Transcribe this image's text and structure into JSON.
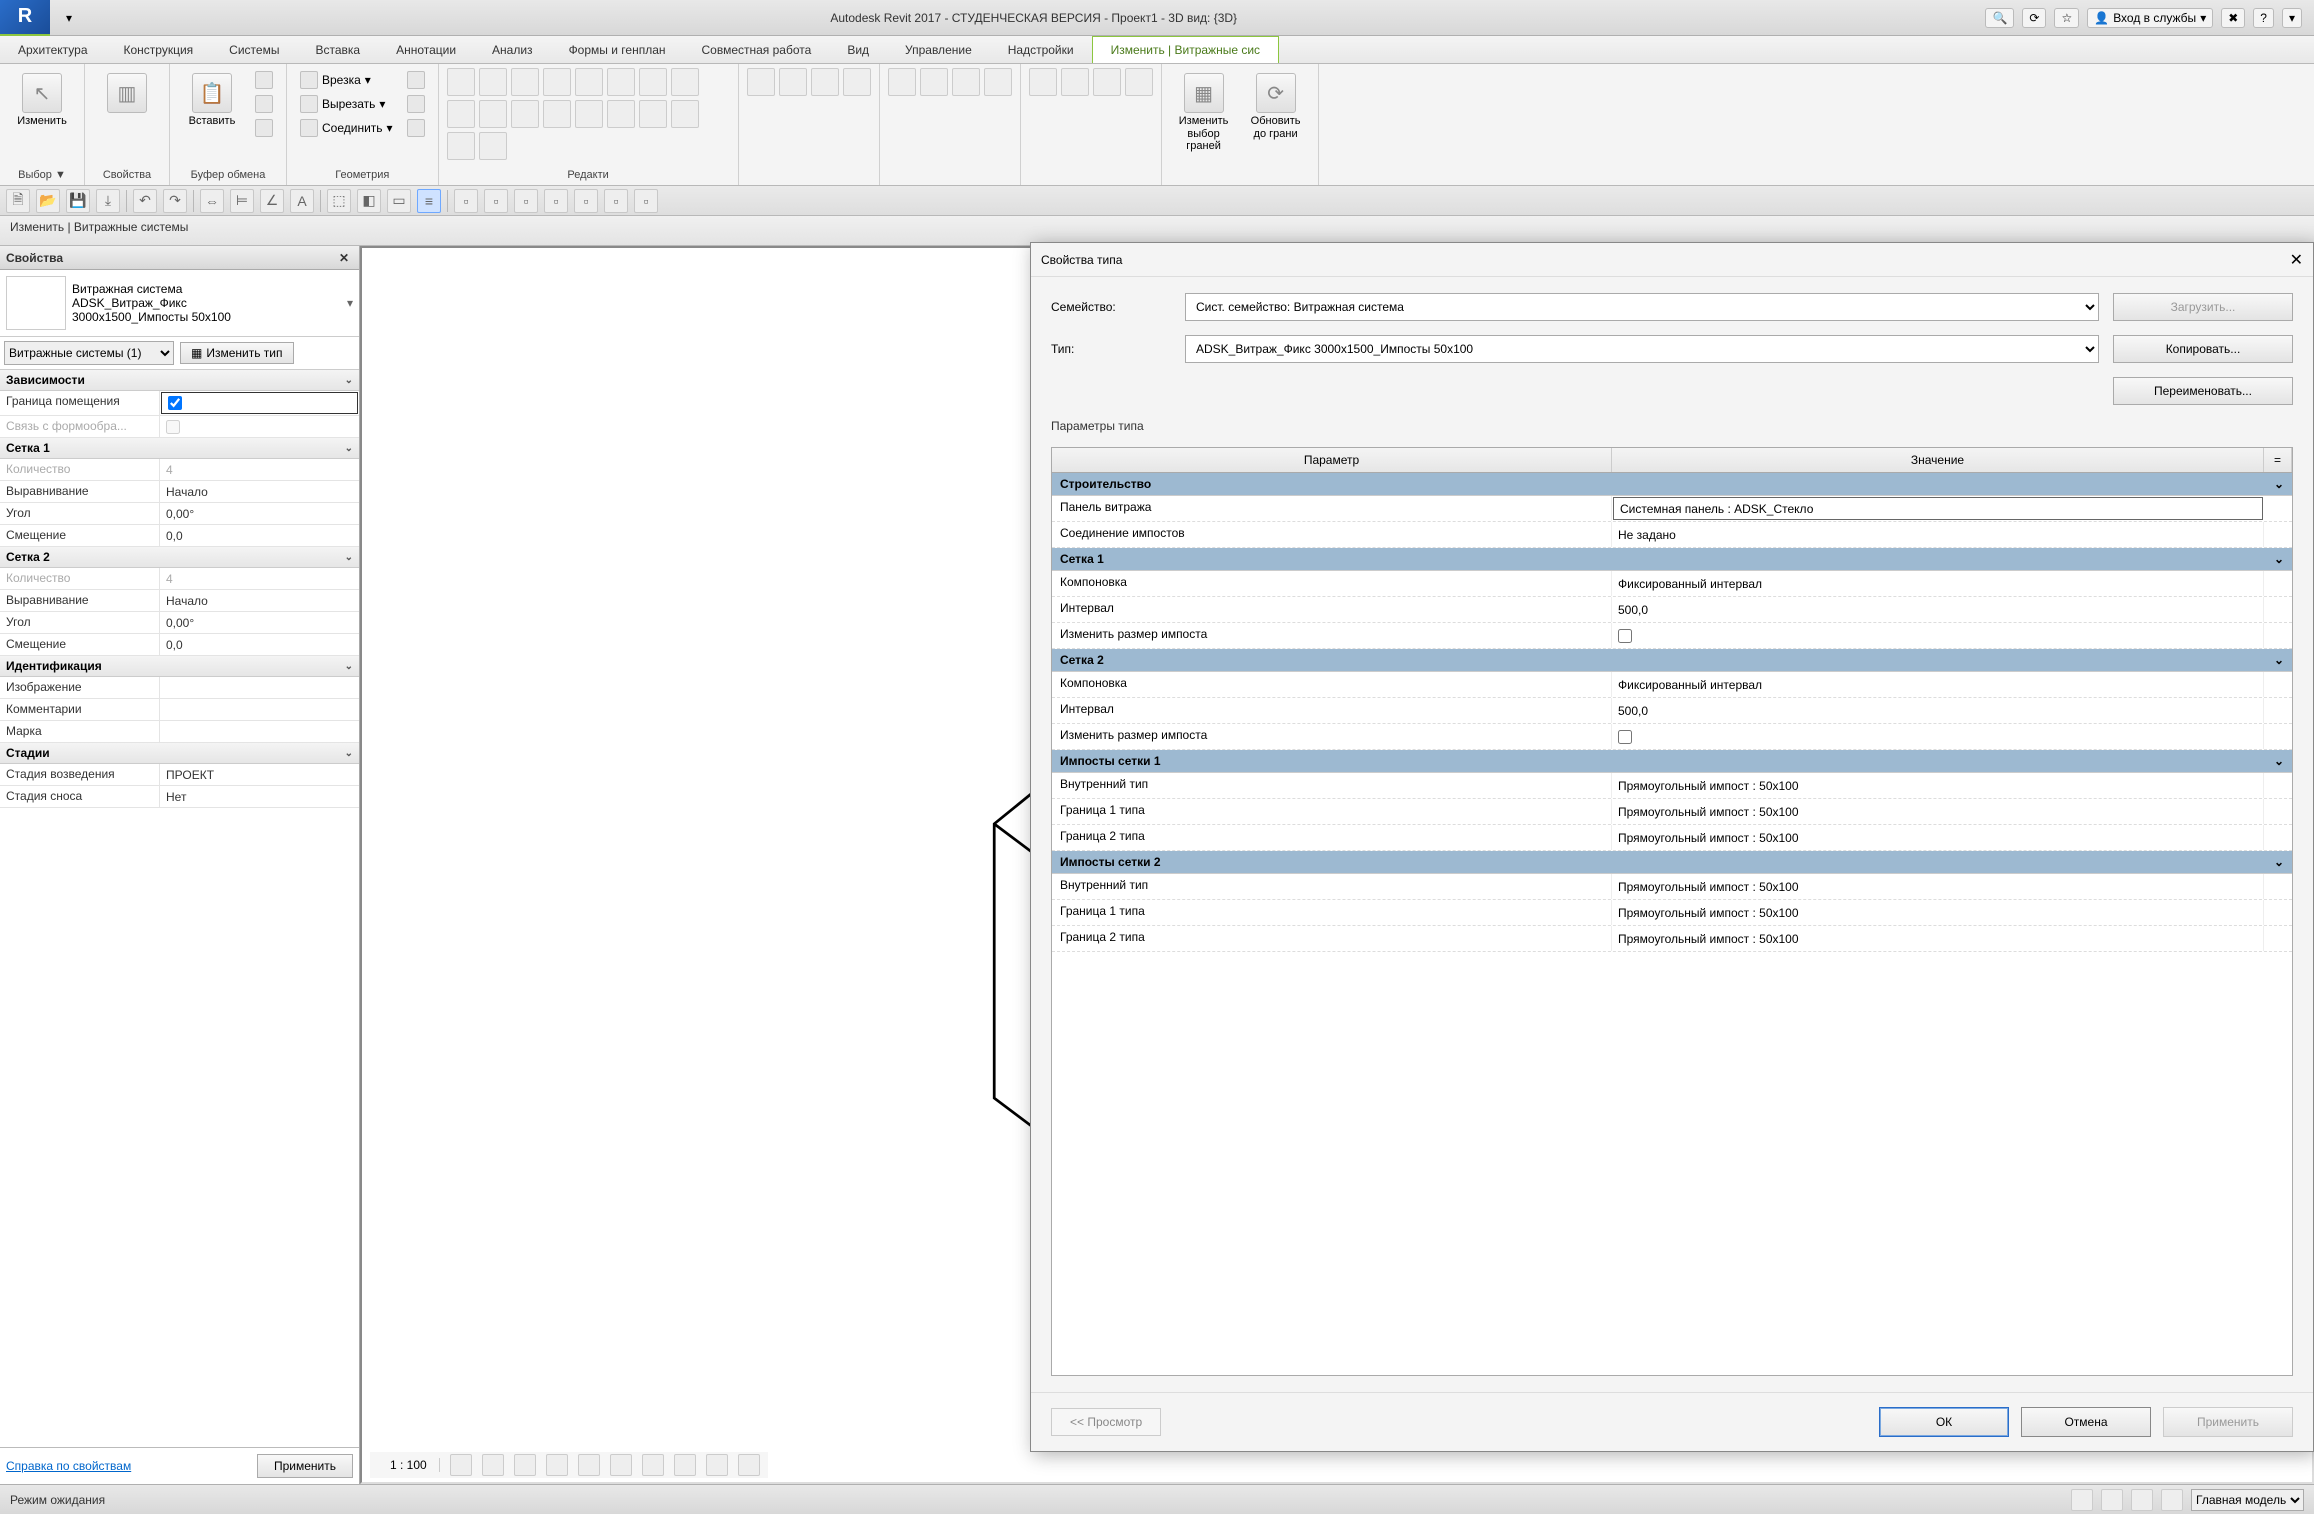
{
  "titlebar": {
    "app": "Autodesk Revit 2017 - СТУДЕНЧЕСКАЯ ВЕРСИЯ -    Проект1 - 3D вид: {3D}",
    "logo": "R",
    "signin": "Вход в службы"
  },
  "menubar": {
    "items": [
      "Архитектура",
      "Конструкция",
      "Системы",
      "Вставка",
      "Аннотации",
      "Анализ",
      "Формы и генплан",
      "Совместная работа",
      "Вид",
      "Управление",
      "Надстройки",
      "Изменить | Витражные сис"
    ]
  },
  "ribbon": {
    "panels": [
      {
        "label": "Выбор ▼",
        "big": [
          {
            "t": "Изменить"
          }
        ]
      },
      {
        "label": "Свойства",
        "big": [
          {
            "t": ""
          }
        ]
      },
      {
        "label": "Буфер обмена",
        "big": [
          {
            "t": "Вставить"
          }
        ]
      },
      {
        "label": "Геометрия",
        "small": [
          "Врезка",
          "Вырезать",
          "Соединить"
        ]
      },
      {
        "label": "Редакти"
      },
      {
        "label": ""
      },
      {
        "label": ""
      },
      {
        "label": "",
        "big": [
          {
            "t": "Изменить выбор граней"
          },
          {
            "t": "Обновить до грани"
          }
        ]
      }
    ]
  },
  "contextbar": {
    "text": "Изменить | Витражные системы"
  },
  "props": {
    "title": "Свойства",
    "type_header": "Витражная система",
    "type_line2": "ADSK_Витраж_Фикс",
    "type_line3": "3000x1500_Импосты 50x100",
    "filter": "Витражные системы (1)",
    "edit_type": "Изменить тип",
    "groups": [
      {
        "name": "Зависимости",
        "rows": [
          {
            "k": "Граница помещения",
            "v": "",
            "check": true,
            "checked": true,
            "frame": true
          },
          {
            "k": "Связь с формообра...",
            "v": "",
            "check": true,
            "checked": false,
            "dis": true
          }
        ]
      },
      {
        "name": "Сетка 1",
        "rows": [
          {
            "k": "Количество",
            "v": "4",
            "dis": true
          },
          {
            "k": "Выравнивание",
            "v": "Начало"
          },
          {
            "k": "Угол",
            "v": "0,00°"
          },
          {
            "k": "Смещение",
            "v": "0,0"
          }
        ]
      },
      {
        "name": "Сетка 2",
        "rows": [
          {
            "k": "Количество",
            "v": "4",
            "dis": true
          },
          {
            "k": "Выравнивание",
            "v": "Начало"
          },
          {
            "k": "Угол",
            "v": "0,00°"
          },
          {
            "k": "Смещение",
            "v": "0,0"
          }
        ]
      },
      {
        "name": "Идентификация",
        "rows": [
          {
            "k": "Изображение",
            "v": ""
          },
          {
            "k": "Комментарии",
            "v": ""
          },
          {
            "k": "Марка",
            "v": ""
          }
        ]
      },
      {
        "name": "Стадии",
        "rows": [
          {
            "k": "Стадия возведения",
            "v": "ПРОЕКТ"
          },
          {
            "k": "Стадия сноса",
            "v": "Нет"
          }
        ]
      }
    ],
    "help": "Справка по свойствам",
    "apply": "Применить"
  },
  "view": {
    "scale": "1 : 100"
  },
  "statusbar": {
    "mode": "Режим ожидания",
    "model": "Главная модель"
  },
  "dialog": {
    "title": "Свойства типа",
    "close": "✕",
    "family_label": "Семейство:",
    "family_value": "Сист. семейство: Витражная система",
    "type_label": "Тип:",
    "type_value": "ADSK_Витраж_Фикс 3000x1500_Импосты 50x100",
    "load": "Загрузить...",
    "copy": "Копировать...",
    "rename": "Переименовать...",
    "params_label": "Параметры типа",
    "hdr_param": "Параметр",
    "hdr_value": "Значение",
    "hdr_eq": "=",
    "groups": [
      {
        "name": "Строительство",
        "rows": [
          {
            "k": "Панель витража",
            "v": "Системная панель : ADSK_Стекло",
            "frame": true
          },
          {
            "k": "Соединение импостов",
            "v": "Не задано"
          }
        ]
      },
      {
        "name": "Сетка 1",
        "rows": [
          {
            "k": "Компоновка",
            "v": "Фиксированный интервал"
          },
          {
            "k": "Интервал",
            "v": "500,0"
          },
          {
            "k": "Изменить размер импоста",
            "v": "",
            "check": true,
            "checked": false
          }
        ]
      },
      {
        "name": "Сетка 2",
        "rows": [
          {
            "k": "Компоновка",
            "v": "Фиксированный интервал"
          },
          {
            "k": "Интервал",
            "v": "500,0"
          },
          {
            "k": "Изменить размер импоста",
            "v": "",
            "check": true,
            "checked": false
          }
        ]
      },
      {
        "name": "Импосты сетки 1",
        "rows": [
          {
            "k": "Внутренний тип",
            "v": "Прямоугольный импост : 50x100"
          },
          {
            "k": "Граница 1 типа",
            "v": "Прямоугольный импост : 50x100"
          },
          {
            "k": "Граница 2 типа",
            "v": "Прямоугольный импост : 50x100"
          }
        ]
      },
      {
        "name": "Импосты сетки 2",
        "rows": [
          {
            "k": "Внутренний тип",
            "v": "Прямоугольный импост : 50x100"
          },
          {
            "k": "Граница 1 типа",
            "v": "Прямоугольный импост : 50x100"
          },
          {
            "k": "Граница 2 типа",
            "v": "Прямоугольный импост : 50x100"
          }
        ]
      }
    ],
    "preview": "<< Просмотр",
    "ok": "ОК",
    "cancel": "Отмена",
    "apply": "Применить"
  }
}
